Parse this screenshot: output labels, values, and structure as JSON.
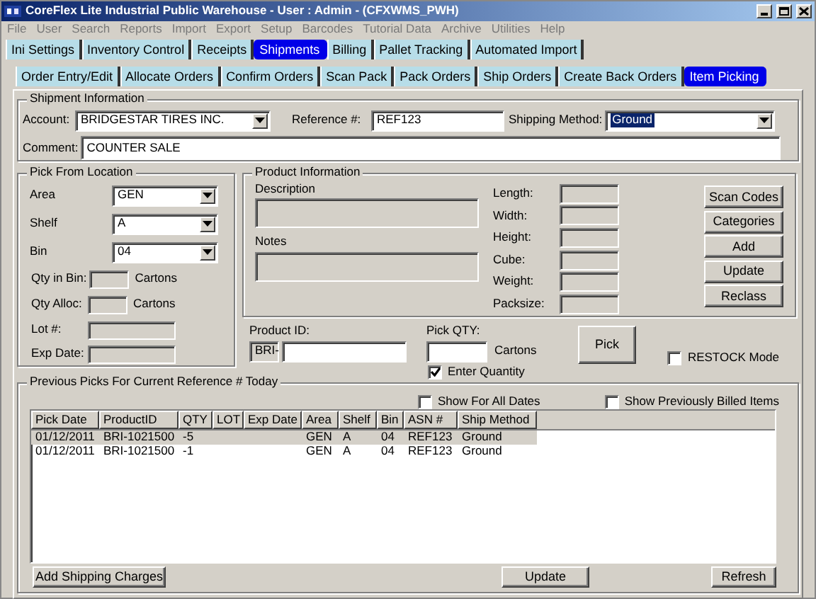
{
  "window": {
    "title": "CoreFlex Lite Industrial Public Warehouse - User : Admin - (CFXWMS_PWH)"
  },
  "menu": [
    "File",
    "User",
    "Search",
    "Reports",
    "Import",
    "Export",
    "Setup",
    "Barcodes",
    "Tutorial Data",
    "Archive",
    "Utilities",
    "Help"
  ],
  "main_tabs": [
    {
      "label": "Ini Settings",
      "selected": false
    },
    {
      "label": "Inventory Control",
      "selected": false
    },
    {
      "label": "Receipts",
      "selected": false
    },
    {
      "label": "Shipments",
      "selected": true
    },
    {
      "label": "Billing",
      "selected": false
    },
    {
      "label": "Pallet Tracking",
      "selected": false
    },
    {
      "label": "Automated Import",
      "selected": false
    }
  ],
  "sub_tabs": [
    {
      "label": "Order Entry/Edit",
      "selected": false
    },
    {
      "label": "Allocate Orders",
      "selected": false
    },
    {
      "label": "Confirm Orders",
      "selected": false
    },
    {
      "label": "Scan Pack",
      "selected": false
    },
    {
      "label": "Pack Orders",
      "selected": false
    },
    {
      "label": "Ship Orders",
      "selected": false
    },
    {
      "label": "Create Back Orders",
      "selected": false
    },
    {
      "label": "Item Picking",
      "selected": true
    }
  ],
  "shipment_information": {
    "title": "Shipment Information",
    "account": {
      "label": "Account:",
      "value": "BRIDGESTAR TIRES INC."
    },
    "reference": {
      "label": "Reference #:",
      "value": "REF123"
    },
    "shipping_method": {
      "label": "Shipping Method:",
      "value": "Ground"
    },
    "comment": {
      "label": "Comment:",
      "value": "COUNTER SALE"
    }
  },
  "pick_from_location": {
    "title": "Pick From Location",
    "selects": [
      {
        "label": "Area",
        "value": "GEN"
      },
      {
        "label": "Shelf",
        "value": "A"
      },
      {
        "label": "Bin",
        "value": "04"
      }
    ],
    "qty_fields": [
      {
        "label": "Qty in Bin:",
        "unit": "Cartons"
      },
      {
        "label": "Qty Alloc:",
        "unit": "Cartons"
      }
    ],
    "fields": [
      {
        "label": "Lot #:"
      },
      {
        "label": "Exp Date:"
      }
    ]
  },
  "product_information": {
    "title": "Product Information",
    "description_label": "Description",
    "notes_label": "Notes",
    "measurements": [
      "Length:",
      "Width:",
      "Height:",
      "Cube:",
      "Weight:",
      "Packsize:"
    ],
    "buttons": [
      "Scan Codes",
      "Categories",
      "Add",
      "Update",
      "Reclass"
    ]
  },
  "product_id": {
    "label": "Product ID:",
    "prefix": "BRI-"
  },
  "pick_qty": {
    "label": "Pick QTY:",
    "unit": "Cartons"
  },
  "enter_quantity": {
    "label": "Enter Quantity",
    "checked": true
  },
  "pick_button": "Pick",
  "restock_mode": {
    "label": "RESTOCK Mode",
    "checked": false
  },
  "previous_picks": {
    "title": "Previous Picks For Current Reference # Today",
    "options": [
      {
        "label": "Show For All Dates",
        "checked": false
      },
      {
        "label": "Show Previously Billed Items",
        "checked": false
      }
    ],
    "table": {
      "columns": [
        "Pick Date",
        "ProductID",
        "QTY",
        "LOT",
        "Exp Date",
        "Area",
        "Shelf",
        "Bin",
        "ASN #",
        "Ship Method"
      ],
      "rows": [
        {
          "selected": true,
          "cells": [
            "01/12/2011",
            "BRI-1021500",
            "-5",
            "",
            "",
            "GEN",
            "A",
            "04",
            "REF123",
            "Ground"
          ]
        },
        {
          "selected": false,
          "cells": [
            "01/12/2011",
            "BRI-1021500",
            "-1",
            "",
            "",
            "GEN",
            "A",
            "04",
            "REF123",
            "Ground"
          ]
        }
      ]
    },
    "buttons": [
      "Add Shipping Charges",
      "Update",
      "Refresh"
    ]
  }
}
